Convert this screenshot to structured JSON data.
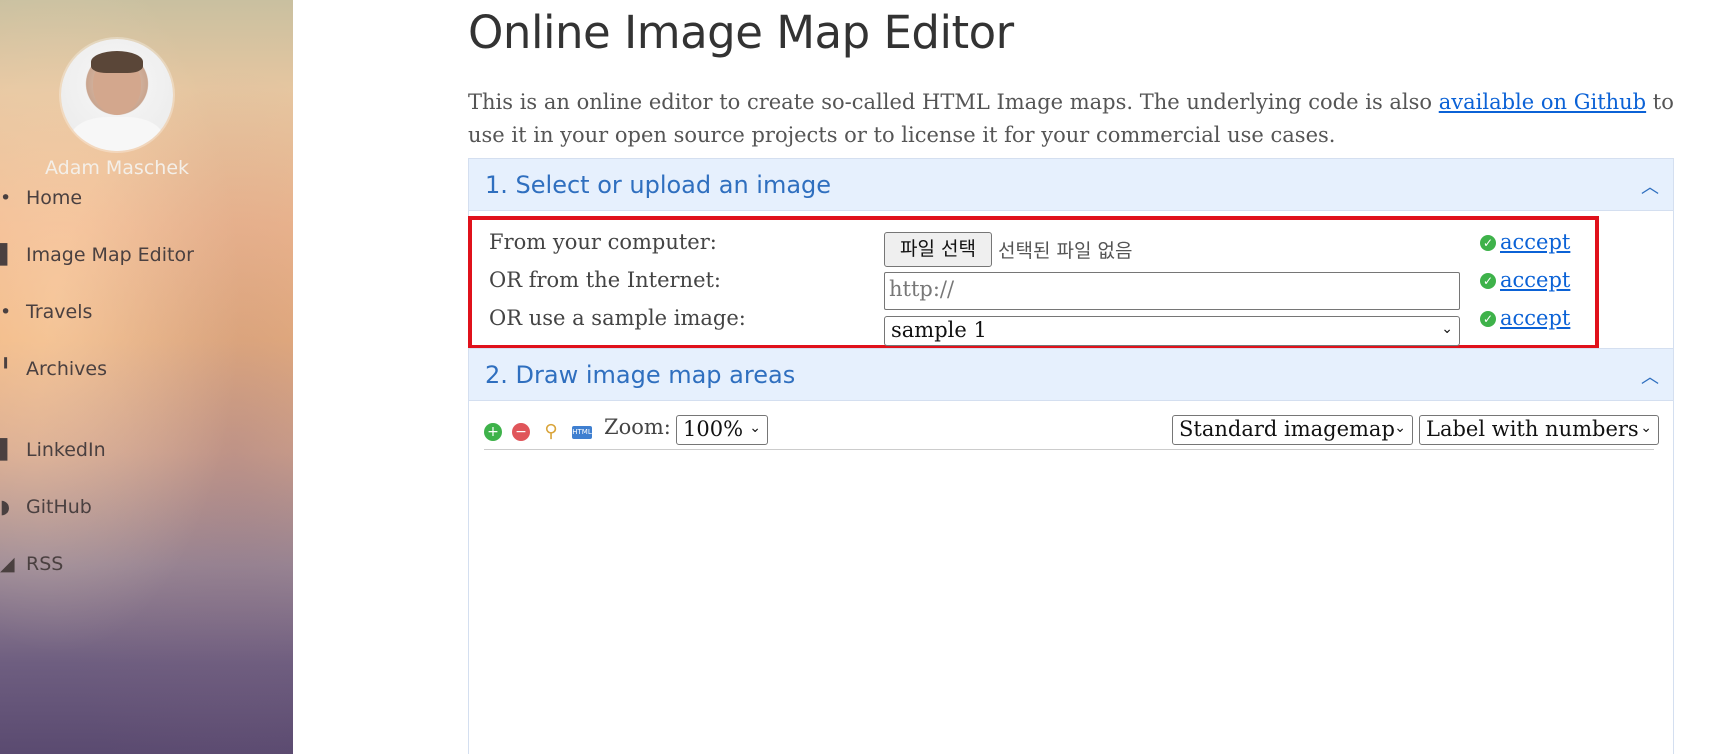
{
  "sidebar": {
    "author": "Adam Maschek",
    "nav": [
      {
        "label": "Home"
      },
      {
        "label": "Image Map Editor"
      },
      {
        "label": "Travels"
      },
      {
        "label": "Archives"
      },
      {
        "label": "LinkedIn"
      },
      {
        "label": "GitHub"
      },
      {
        "label": "RSS"
      }
    ]
  },
  "page": {
    "title": "Online Image Map Editor",
    "intro_before": "This is an online editor to create so-called HTML Image maps. The underlying code is also ",
    "intro_link": "available on Github",
    "intro_after": " to use it in your open source projects or to license it for your commercial use cases."
  },
  "section1": {
    "title": "1. Select or upload an image",
    "rows": [
      {
        "label": "From your computer:"
      },
      {
        "label": "OR from the Internet:"
      },
      {
        "label": "OR use a sample image:"
      }
    ],
    "file_button": "파일 선택",
    "file_status": "선택된 파일 없음",
    "url_placeholder": "http://",
    "sample_selected": "sample 1",
    "accept_label": "accept"
  },
  "section2": {
    "title": "2. Draw image map areas",
    "zoom_label": "Zoom:",
    "zoom_value": "100%",
    "map_type": "Standard imagemap",
    "label_mode": "Label with numbers",
    "icons": [
      "add-icon",
      "remove-icon",
      "preview-icon",
      "html-icon"
    ]
  },
  "colors": {
    "accent": "#2f6fbf",
    "link": "#0b62d6",
    "highlight_border": "#e0111b",
    "panel_bg": "#e6f0fd"
  }
}
